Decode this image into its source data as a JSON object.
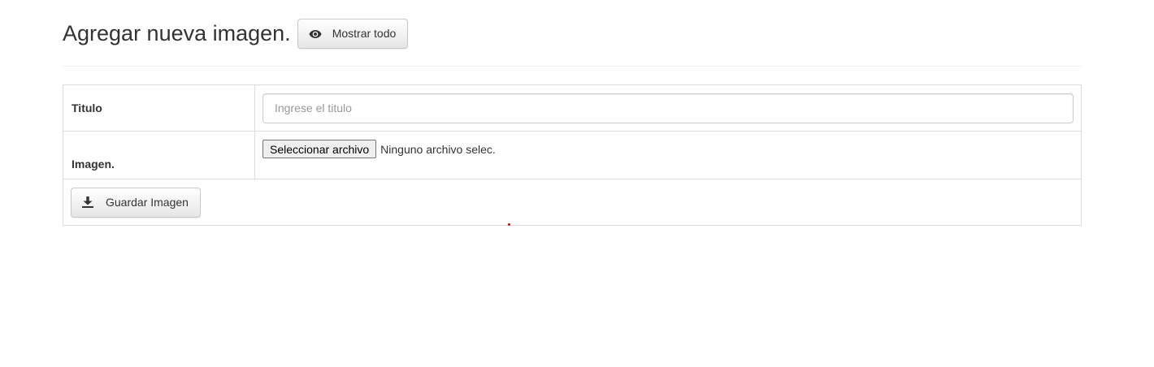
{
  "header": {
    "title": "Agregar nueva imagen.",
    "show_all_label": "Mostrar todo",
    "show_all_icon": "eye-icon"
  },
  "form": {
    "titulo": {
      "label": "Titulo",
      "value": "",
      "placeholder": "Ingrese el titulo"
    },
    "imagen": {
      "label": "Imagen.",
      "file_button_label": "Seleccionar archivo",
      "file_status": "Ninguno archivo selec."
    },
    "save": {
      "label": "Guardar Imagen",
      "icon": "download-icon"
    }
  },
  "colors": {
    "text": "#333333",
    "border": "#dddddd",
    "button_bg_top": "#ffffff",
    "button_bg_bottom": "#e6e6e6",
    "indicator": "#cc0000"
  }
}
